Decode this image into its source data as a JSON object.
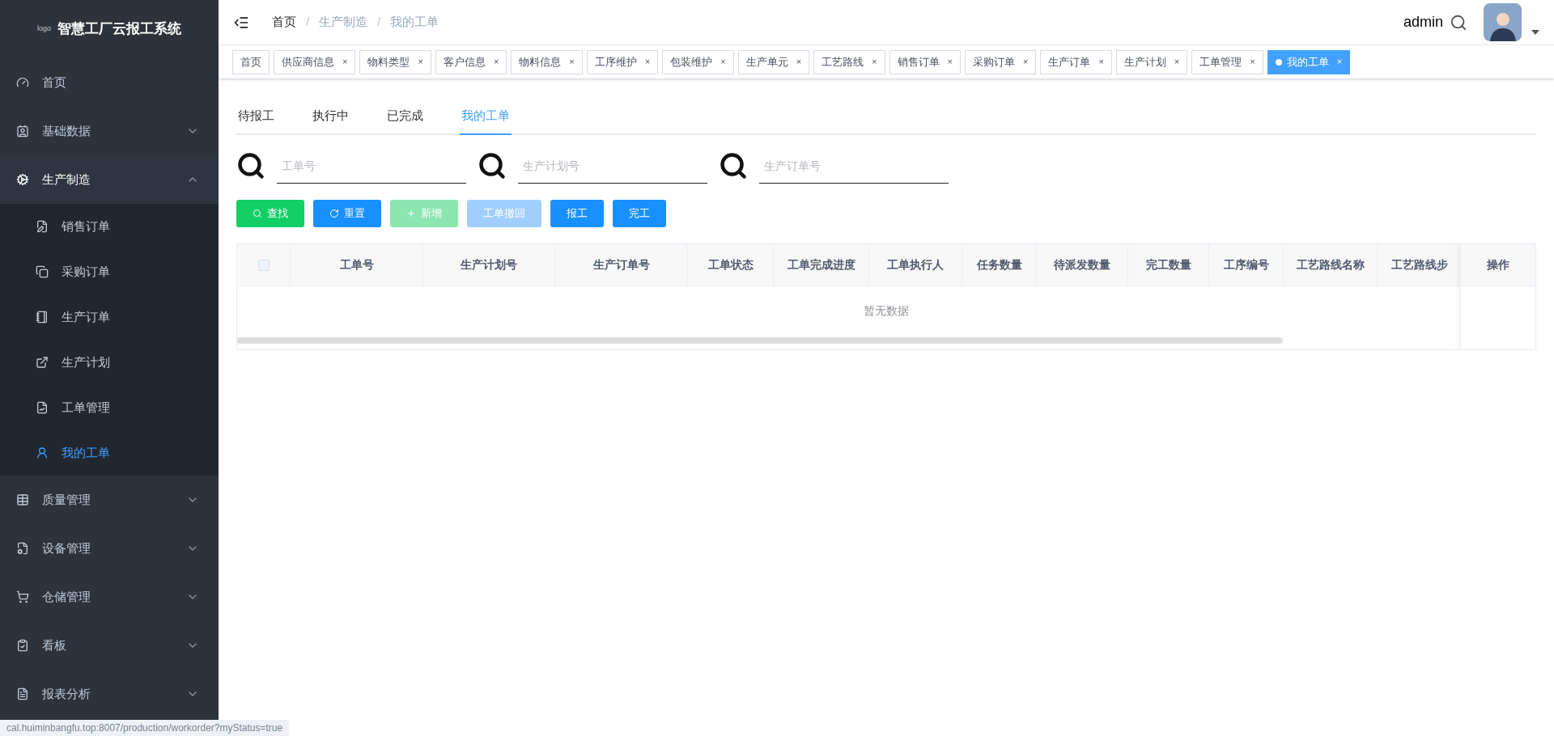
{
  "sidebar": {
    "logo": "logo",
    "title": "智慧工厂云报工系统",
    "items": [
      {
        "label": "首页",
        "kind": "link",
        "selected": false
      },
      {
        "label": "基础数据",
        "kind": "group",
        "expanded": false,
        "selected": false
      },
      {
        "label": "生产制造",
        "kind": "group",
        "expanded": true,
        "selected": false,
        "children": [
          {
            "label": "销售订单",
            "selected": false
          },
          {
            "label": "采购订单",
            "selected": false
          },
          {
            "label": "生产订单",
            "selected": false
          },
          {
            "label": "生产计划",
            "selected": false
          },
          {
            "label": "工单管理",
            "selected": false
          },
          {
            "label": "我的工单",
            "selected": true
          }
        ]
      },
      {
        "label": "质量管理",
        "kind": "group",
        "expanded": false,
        "selected": false
      },
      {
        "label": "设备管理",
        "kind": "group",
        "expanded": false,
        "selected": false
      },
      {
        "label": "仓储管理",
        "kind": "group",
        "expanded": false,
        "selected": false
      },
      {
        "label": "看板",
        "kind": "group",
        "expanded": false,
        "selected": false
      },
      {
        "label": "报表分析",
        "kind": "group",
        "expanded": false,
        "selected": false
      }
    ]
  },
  "breadcrumb": [
    "首页",
    "生产制造",
    "我的工单"
  ],
  "breadcrumb_separator": "/",
  "user": {
    "name": "admin"
  },
  "page_tabs": [
    {
      "label": "首页",
      "closable": false,
      "selected": false
    },
    {
      "label": "供应商信息",
      "closable": true,
      "selected": false
    },
    {
      "label": "物料类型",
      "closable": true,
      "selected": false
    },
    {
      "label": "客户信息",
      "closable": true,
      "selected": false
    },
    {
      "label": "物料信息",
      "closable": true,
      "selected": false
    },
    {
      "label": "工序维护",
      "closable": true,
      "selected": false
    },
    {
      "label": "包装维护",
      "closable": true,
      "selected": false
    },
    {
      "label": "生产单元",
      "closable": true,
      "selected": false
    },
    {
      "label": "工艺路线",
      "closable": true,
      "selected": false
    },
    {
      "label": "销售订单",
      "closable": true,
      "selected": false
    },
    {
      "label": "采购订单",
      "closable": true,
      "selected": false
    },
    {
      "label": "生产订单",
      "closable": true,
      "selected": false
    },
    {
      "label": "生产计划",
      "closable": true,
      "selected": false
    },
    {
      "label": "工单管理",
      "closable": true,
      "selected": false
    },
    {
      "label": "我的工单",
      "closable": true,
      "selected": true
    }
  ],
  "close_glyph": "×",
  "status_tabs": [
    {
      "label": "待报工",
      "selected": false
    },
    {
      "label": "执行中",
      "selected": false
    },
    {
      "label": "已完成",
      "selected": false
    },
    {
      "label": "我的工单",
      "selected": true
    }
  ],
  "search_fields": [
    {
      "placeholder": "工单号"
    },
    {
      "placeholder": "生产计划号"
    },
    {
      "placeholder": "生产订单号"
    }
  ],
  "buttons": [
    {
      "label": "查找",
      "kind": "search",
      "disabled": false
    },
    {
      "label": "重置",
      "kind": "reset",
      "disabled": false
    },
    {
      "label": "新增",
      "kind": "add",
      "disabled": true
    },
    {
      "label": "工单撤回",
      "kind": "revoke",
      "disabled": true
    },
    {
      "label": "报工",
      "kind": "plain",
      "disabled": false
    },
    {
      "label": "完工",
      "kind": "plain",
      "disabled": false
    }
  ],
  "table": {
    "select_all_checked": false,
    "columns": [
      "工单号",
      "生产计划号",
      "生产订单号",
      "工单状态",
      "工单完成进度",
      "工单执行人",
      "任务数量",
      "待派发数量",
      "完工数量",
      "工序编号",
      "工艺路线名称",
      "工艺路线步"
    ],
    "action_column": "操作",
    "empty_text": "暂无数据"
  },
  "status_url": "cal.huiminbangfu.top:8007/production/workorder?myStatus=true"
}
